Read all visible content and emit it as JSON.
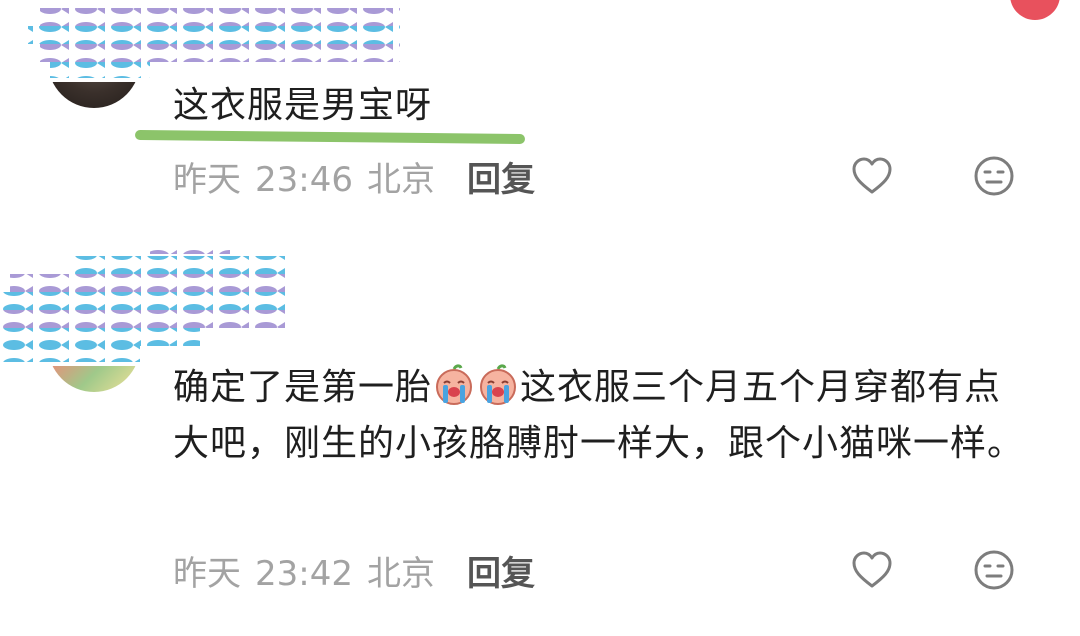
{
  "comments": [
    {
      "text": "这衣服是男宝呀",
      "date": "昨天",
      "time": "23:46",
      "location": "北京",
      "reply_label": "回复"
    },
    {
      "text_part1": "确定了是第一胎",
      "text_part2": "这衣服三个月五个月穿都有点大吧，刚生的小孩胳膊肘一样大，跟个小猫咪一样。",
      "date": "昨天",
      "time": "23:42",
      "location": "北京",
      "reply_label": "回复"
    }
  ],
  "icons": {
    "like": "heart-outline-icon",
    "dislike": "neutral-face-icon",
    "emoji": "crying-face-emoji"
  },
  "colors": {
    "highlight": "#8cc46a",
    "meta_text": "#a3a3a3",
    "notification_dot": "#e8515d"
  }
}
